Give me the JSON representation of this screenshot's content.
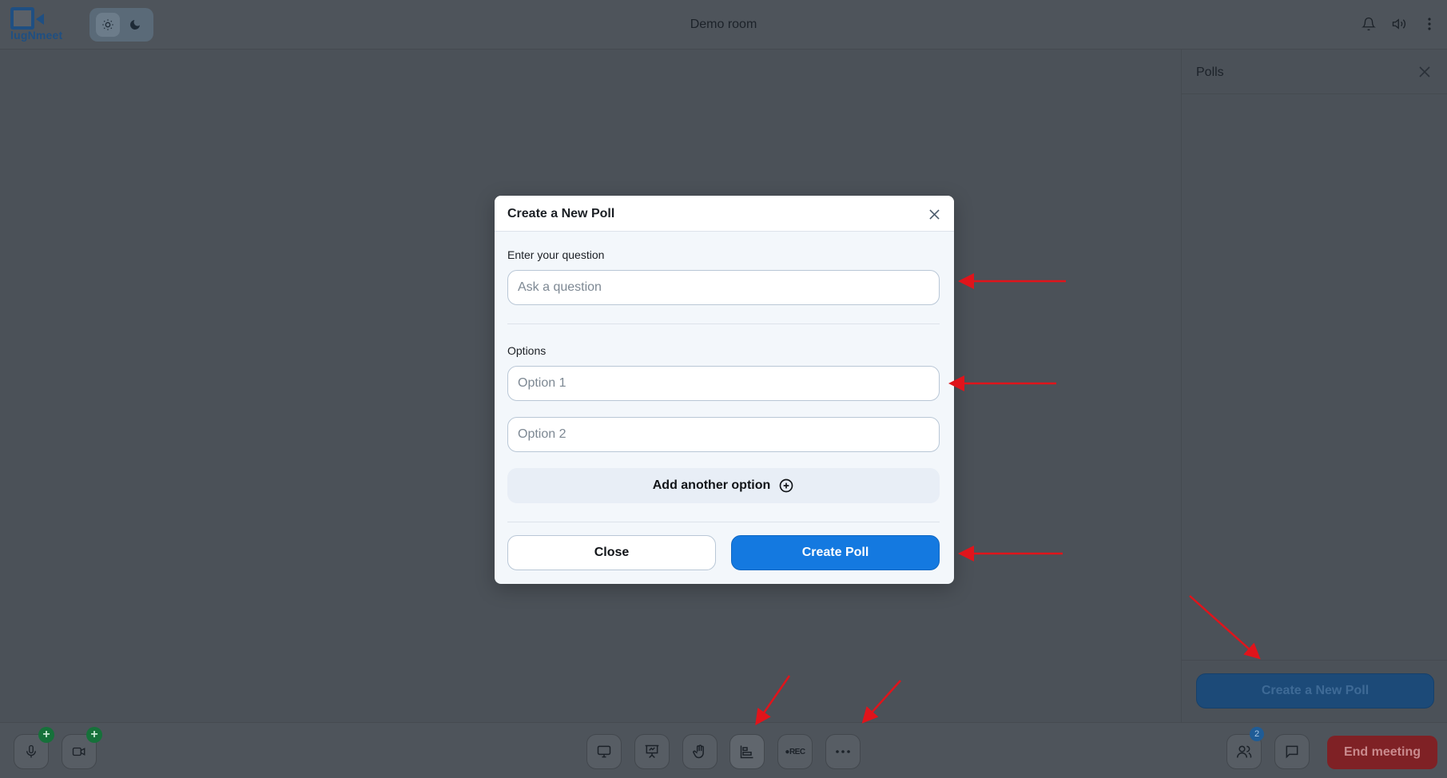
{
  "header": {
    "logo_text": "lugNmeet",
    "room_title": "Demo room",
    "icons": [
      "sun-icon",
      "moon-icon",
      "bell-icon",
      "speaker-icon",
      "more-vertical-icon"
    ]
  },
  "polls_panel": {
    "title": "Polls",
    "create_button_label": "Create a New Poll"
  },
  "modal": {
    "title": "Create a New Poll",
    "question_label": "Enter your question",
    "question_placeholder": "Ask a question",
    "question_value": "",
    "options_label": "Options",
    "options": [
      {
        "placeholder": "Option 1",
        "value": ""
      },
      {
        "placeholder": "Option 2",
        "value": ""
      }
    ],
    "add_option_label": "Add another option",
    "close_label": "Close",
    "create_label": "Create Poll"
  },
  "footer": {
    "rec_label": "●REC",
    "participants_count": "2",
    "end_meeting_label": "End meeting",
    "plus_badge": "+"
  },
  "colors": {
    "primary": "#1479e0",
    "danger": "#7f2125",
    "badge_green": "#16713a",
    "annotation_red": "#e0141b"
  }
}
